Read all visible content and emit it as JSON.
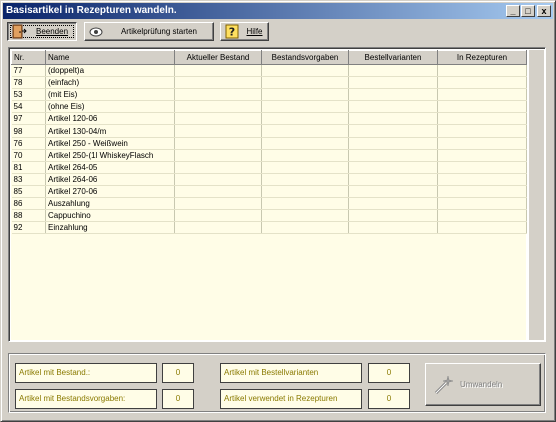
{
  "window": {
    "title": "Basisartikel in Rezepturen wandeln.",
    "controls": {
      "minimize": "_",
      "maximize": "□",
      "close": "x"
    }
  },
  "toolbar": {
    "beenden": {
      "label": "Beenden",
      "icon": "exit-door-icon"
    },
    "pruefung": {
      "label": "Artikelprüfung starten",
      "icon": "check-icon"
    },
    "hilfe": {
      "label": "Hilfe",
      "icon": "help-icon"
    }
  },
  "grid": {
    "columns": [
      "Nr.",
      "Name",
      "Aktueller Bestand",
      "Bestandsvorgaben",
      "Bestellvarianten",
      "In Rezepturen"
    ],
    "rows": [
      {
        "nr": "77",
        "name": "(doppelt)a"
      },
      {
        "nr": "78",
        "name": "(einfach)"
      },
      {
        "nr": "53",
        "name": "(mit Eis)"
      },
      {
        "nr": "54",
        "name": "(ohne Eis)"
      },
      {
        "nr": "97",
        "name": "Artikel 120-06"
      },
      {
        "nr": "98",
        "name": "Artikel 130-04/m"
      },
      {
        "nr": "76",
        "name": "Artikel 250 - Weißwein"
      },
      {
        "nr": "70",
        "name": "Artikel 250-(1l WhiskeyFlasch"
      },
      {
        "nr": "81",
        "name": "Artikel 264-05"
      },
      {
        "nr": "83",
        "name": "Artikel 264-06"
      },
      {
        "nr": "85",
        "name": "Artikel 270-06"
      },
      {
        "nr": "86",
        "name": "Auszahlung"
      },
      {
        "nr": "88",
        "name": "Cappuchino"
      },
      {
        "nr": "92",
        "name": "Einzahlung"
      }
    ]
  },
  "summary": {
    "bestand_label": "Artikel mit Bestand.:",
    "bestand_value": "0",
    "vorgaben_label": "Artikel mit Bestandsvorgaben:",
    "vorgaben_value": "0",
    "varianten_label": "Artikel mit Bestellvarianten",
    "varianten_value": "0",
    "rezepturen_label": "Artikel verwendet in Rezepturen",
    "rezepturen_value": "0"
  },
  "convert_button": {
    "label": "Umwandeln",
    "icon": "magic-wand-icon",
    "enabled": false
  },
  "colors": {
    "grid_background": "#fffde7",
    "title_gradient_start": "#0a246a",
    "disabled_text": "#808080"
  }
}
